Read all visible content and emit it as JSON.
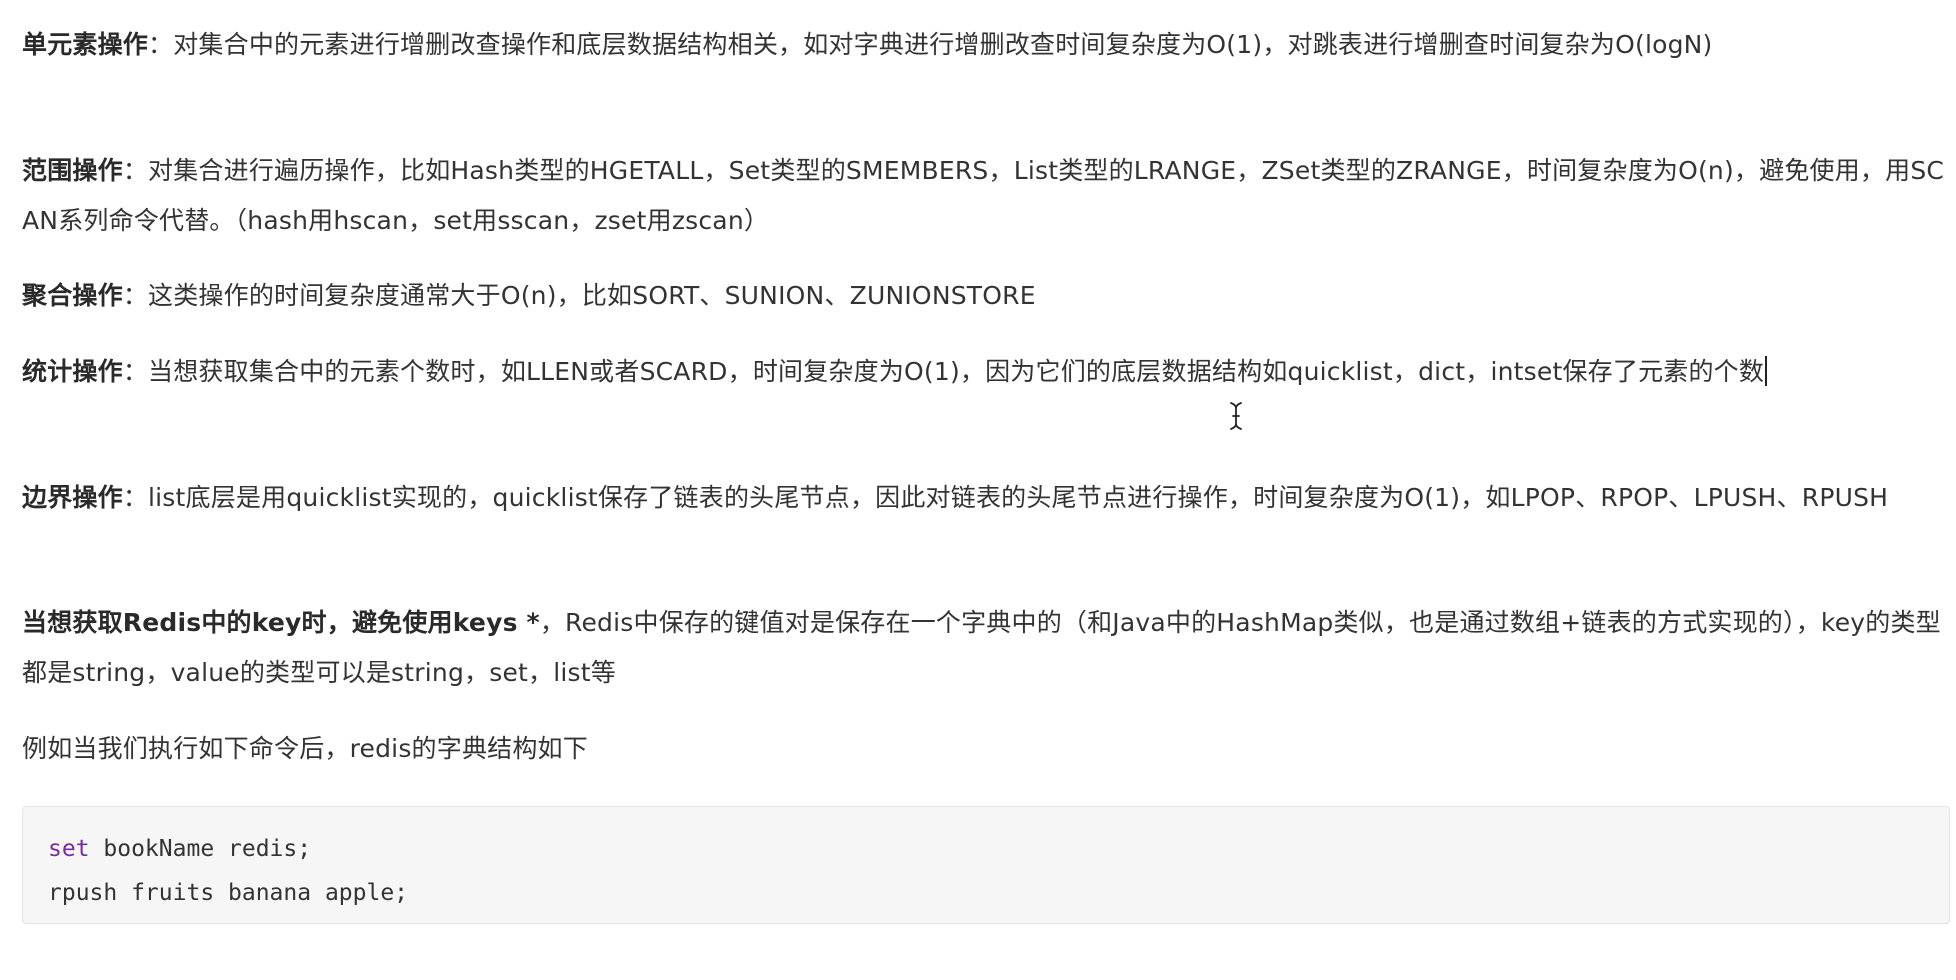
{
  "paragraphs": [
    {
      "bold": "单元素操作",
      "sep": "：",
      "text": "对集合中的元素进行增删改查操作和底层数据结构相关，如对字典进行增删改查时间复杂度为O(1)，对跳表进行增删查时间复杂为O(logN)"
    },
    {
      "bold": "范围操作",
      "sep": "：",
      "text": "对集合进行遍历操作，比如Hash类型的HGETALL，Set类型的SMEMBERS，List类型的LRANGE，ZSet类型的ZRANGE，时间复杂度为O(n)，避免使用，用SCAN系列命令代替。（hash用hscan，set用sscan，zset用zscan）"
    },
    {
      "bold": "聚合操作",
      "sep": "：",
      "text": "这类操作的时间复杂度通常大于O(n)，比如SORT、SUNION、ZUNIONSTORE"
    },
    {
      "bold": "统计操作",
      "sep": "：",
      "text": "当想获取集合中的元素个数时，如LLEN或者SCARD，时间复杂度为O(1)，因为它们的底层数据结构如quicklist，dict，intset保存了元素的个数"
    },
    {
      "bold": "边界操作",
      "sep": "：",
      "text": "list底层是用quicklist实现的，quicklist保存了链表的头尾节点，因此对链表的头尾节点进行操作，时间复杂度为O(1)，如LPOP、RPOP、LPUSH、RPUSH"
    },
    {
      "bold": "当想获取Redis中的key时，避免使用keys *",
      "sep": "，",
      "text": "Redis中保存的键值对是保存在一个字典中的（和Java中的HashMap类似，也是通过数组+链表的方式实现的），key的类型都是string，value的类型可以是string，set，list等"
    },
    {
      "text": "例如当我们执行如下命令后，redis的字典结构如下"
    }
  ],
  "code": {
    "line1_keyword": "set",
    "line1_rest": " bookName redis;",
    "line2": "rpush fruits banana apple;"
  },
  "icons": {
    "cursor": "text-cursor-ibeam-icon"
  },
  "colors": {
    "keyword": "#7a2aa5",
    "code_bg": "#f6f6f6",
    "text": "#333333"
  }
}
